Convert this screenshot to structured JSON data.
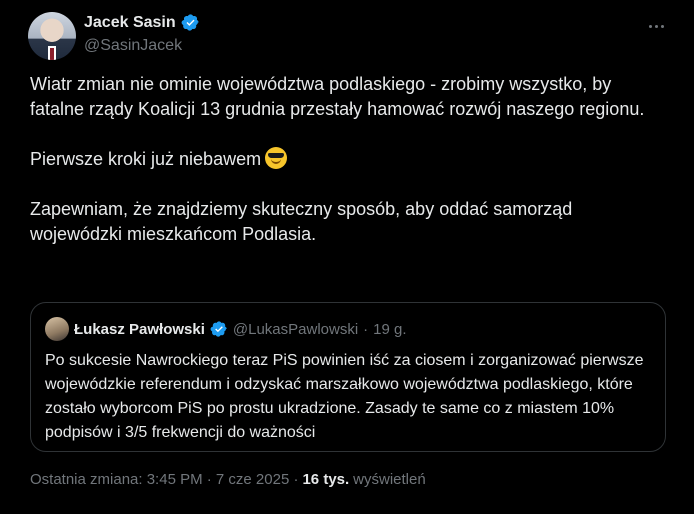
{
  "author": {
    "name": "Jacek Sasin",
    "handle": "@SasinJacek"
  },
  "tweet": {
    "paragraphs": [
      "Wiatr zmian nie ominie województwa podlaskiego - zrobimy wszystko, by fatalne rządy Koalicji 13 grudnia przestały hamować rozwój naszego regionu.",
      "Pierwsze kroki już niebawem",
      "Zapewniam, że znajdziemy skuteczny sposób, aby oddać samorząd wojewódzki mieszkańcom Podlasia."
    ],
    "emoji": "smiling-face-with-sunglasses"
  },
  "quoted": {
    "name": "Łukasz Pawłowski",
    "handle": "@LukasPawlowski",
    "separator": "·",
    "time": "19 g.",
    "text": "Po sukcesie Nawrockiego teraz PiS powinien iść za ciosem i zorganizować pierwsze wojewódzkie referendum i odzyskać marszałkowo województwa podlaskiego, które zostało wyborcom PiS po prostu ukradzione. Zasady te same co z miastem 10% podpisów i 3/5 frekwencji do ważności"
  },
  "meta": {
    "edited_label": "Ostatnia zmiana: 3:45 PM · 7 cze 2025 ·",
    "views_count": "16 tys.",
    "views_label": "wyświetleń"
  },
  "colors": {
    "background": "#000000",
    "text": "#e7e9ea",
    "secondary": "#71767b",
    "verified": "#1d9bf0",
    "border": "#2f3336"
  }
}
